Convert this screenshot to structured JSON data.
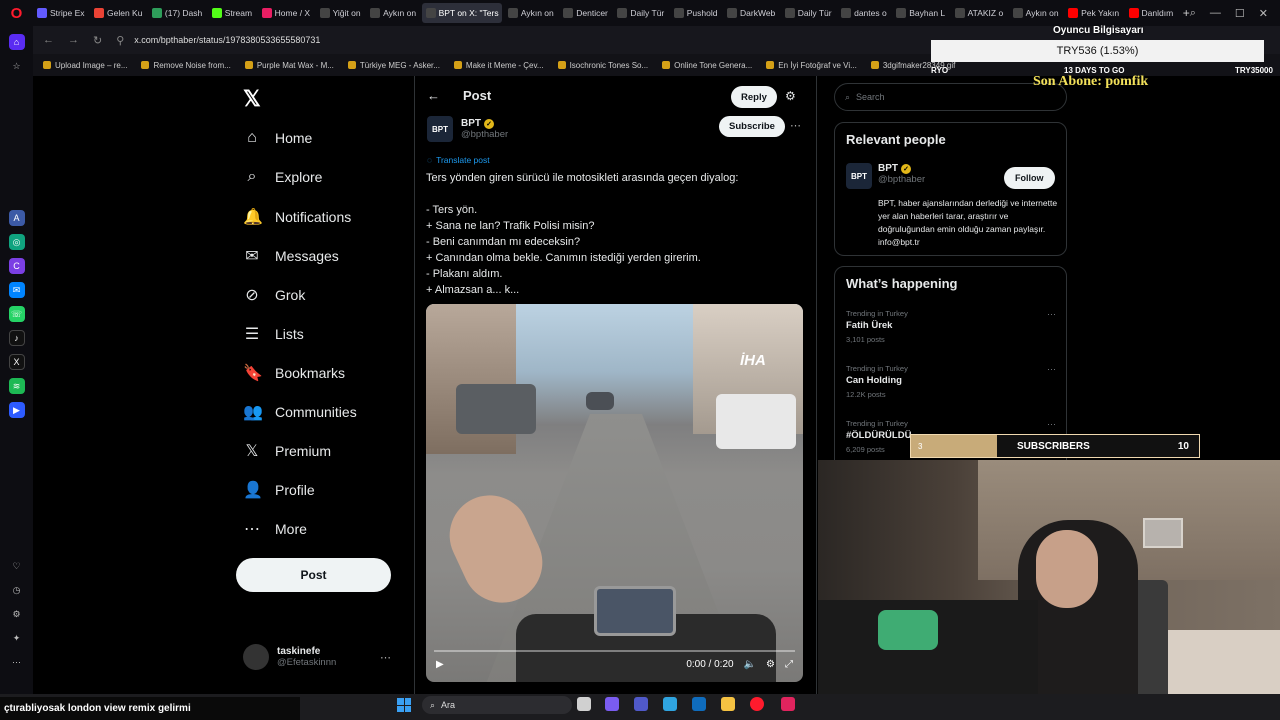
{
  "browser": {
    "tabs": [
      {
        "label": "Stripe Ex",
        "color": "#635bff"
      },
      {
        "label": "Gelen Ku",
        "color": "#ea4335"
      },
      {
        "label": "(17) Dash",
        "color": "#2e9d5a"
      },
      {
        "label": "Stream",
        "color": "#53fc18"
      },
      {
        "label": "Home / X",
        "color": "#e91e63"
      },
      {
        "label": "Yiğit on",
        "color": "#444"
      },
      {
        "label": "Aykın on",
        "color": "#444"
      },
      {
        "label": "BPT on X: \"Ters",
        "color": "#444",
        "active": true
      },
      {
        "label": "Aykın on",
        "color": "#444"
      },
      {
        "label": "Denticer",
        "color": "#444"
      },
      {
        "label": "Daily Tür",
        "color": "#444"
      },
      {
        "label": "Pushold",
        "color": "#444"
      },
      {
        "label": "DarkWeb",
        "color": "#444"
      },
      {
        "label": "Daily Tür",
        "color": "#444"
      },
      {
        "label": "dantes o",
        "color": "#444"
      },
      {
        "label": "Bayhan L",
        "color": "#444"
      },
      {
        "label": "ATAKIZ o",
        "color": "#444"
      },
      {
        "label": "Aykın on",
        "color": "#444"
      },
      {
        "label": "Pek Yakın",
        "color": "#ff0000"
      },
      {
        "label": "Danldım",
        "color": "#ff0000"
      }
    ],
    "url": "x.com/bpthaber/status/1978380533655580731",
    "bookmarks": [
      "Upload Image – re...",
      "Remove Noise from...",
      "Purple Mat Wax - M...",
      "Türkiye MEG - Asker...",
      "Make it Meme - Çev...",
      "Isochronic Tones So...",
      "Online Tone Genera...",
      "En İyi Fotoğraf ve Vi...",
      "3dgifmaker28349.gif"
    ]
  },
  "xnav": {
    "items": [
      {
        "label": "Home",
        "icon": "home-icon",
        "glyph": "⌂"
      },
      {
        "label": "Explore",
        "icon": "search-icon",
        "glyph": "⌕"
      },
      {
        "label": "Notifications",
        "icon": "bell-icon",
        "glyph": "🔔"
      },
      {
        "label": "Messages",
        "icon": "mail-icon",
        "glyph": "✉"
      },
      {
        "label": "Grok",
        "icon": "grok-icon",
        "glyph": "⊘"
      },
      {
        "label": "Lists",
        "icon": "list-icon",
        "glyph": "☰"
      },
      {
        "label": "Bookmarks",
        "icon": "bookmark-icon",
        "glyph": "🔖"
      },
      {
        "label": "Communities",
        "icon": "people-icon",
        "glyph": "👥"
      },
      {
        "label": "Premium",
        "icon": "x-icon",
        "glyph": "𝕏"
      },
      {
        "label": "Profile",
        "icon": "person-icon",
        "glyph": "👤"
      },
      {
        "label": "More",
        "icon": "more-circle-icon",
        "glyph": "⋯"
      }
    ],
    "post_label": "Post",
    "account": {
      "name": "taskinefe",
      "handle": "@Efetaskinnn"
    }
  },
  "main": {
    "header_title": "Post",
    "reply_label": "Reply",
    "author": {
      "name": "BPT",
      "handle": "@bpthaber",
      "avatar_text": "BPT"
    },
    "subscribe_label": "Subscribe",
    "translate_label": "Translate post",
    "tweet_lines": [
      "Ters yönden giren sürücü ile motosikleti arasında geçen diyalog:",
      "",
      "- Ters yön.",
      "+ Sana ne lan? Trafik Polisi misin?",
      "- Beni canımdan mı edeceksin?",
      "+ Canından olma bekle. Canımın istediği yerden girerim.",
      "- Plakanı aldım.",
      "+ Almazsan a... k..."
    ],
    "video": {
      "watermark": "İHA",
      "time": "0:00 / 0:20",
      "progress": 0
    }
  },
  "right": {
    "search_placeholder": "Search",
    "relevant_title": "Relevant people",
    "relevant": {
      "name": "BPT",
      "handle": "@bpthaber",
      "follow_label": "Follow",
      "bio": "BPT, haber ajanslarından derlediği ve internette yer alan haberleri tarar, araştırır ve doğruluğundan emin olduğu zaman paylaşır. info@bpt.tr"
    },
    "happening_title": "What’s happening",
    "trends": [
      {
        "context": "Trending in Turkey",
        "name": "Fatih Ürek",
        "posts": "3,101 posts"
      },
      {
        "context": "Trending in Turkey",
        "name": "Can Holding",
        "posts": "12.2K posts"
      },
      {
        "context": "Trending in Turkey",
        "name": "#ÖLDÜRÜLDÜ",
        "posts": "6,209 posts"
      }
    ]
  },
  "overlay": {
    "title": "Oyuncu Bilgisayarı",
    "price": "TRY536 (1.53%)",
    "left_label": "RYO",
    "days_left": "13 DAYS TO GO",
    "goal": "TRY35000",
    "last_sub": "Son Abone: pomfik",
    "sub_bar": {
      "current": "3",
      "label": "SUBSCRIBERS",
      "goal": "10",
      "progress": 0.3
    }
  },
  "taskbar": {
    "ticker": "çtırabliyosak london view remix gelirmi",
    "search_label": "Ara"
  }
}
